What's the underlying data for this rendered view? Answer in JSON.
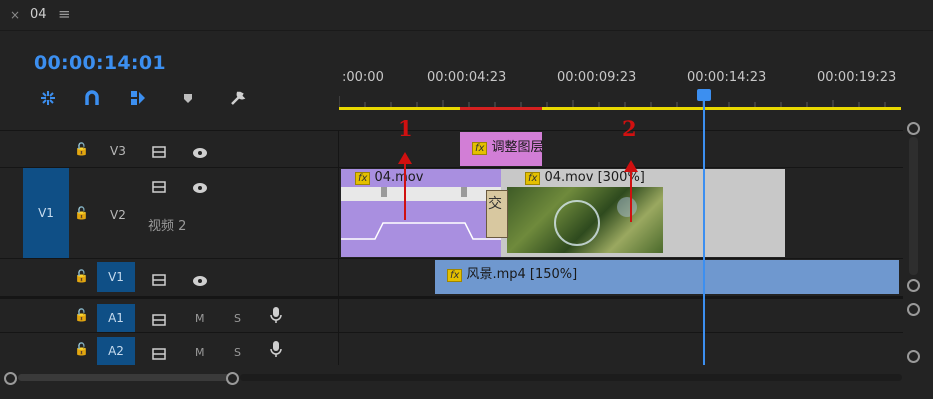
{
  "tab": {
    "close_glyph": "×",
    "name": "04",
    "menu_glyph": "≡"
  },
  "timecode": "00:00:14:01",
  "ruler": {
    "ticks": [
      ":00:00",
      "00:00:04:23",
      "00:00:09:23",
      "00:00:14:23",
      "00:00:19:23"
    ]
  },
  "tracks": {
    "v3": {
      "label": "V3"
    },
    "v2": {
      "label": "V2",
      "name": "视频 2",
      "source_patch": "V1"
    },
    "v1": {
      "label": "V1"
    },
    "a1": {
      "label": "A1",
      "m": "M",
      "s": "S"
    },
    "a2": {
      "label": "A2",
      "m": "M",
      "s": "S"
    }
  },
  "clips": {
    "adjust": {
      "fx": "fx",
      "label": "调整图层"
    },
    "clip1": {
      "fx": "fx",
      "label": "04.mov"
    },
    "clip2": {
      "fx": "fx",
      "label": "04.mov [300%]"
    },
    "transition": {
      "label": "交"
    },
    "scenery": {
      "fx": "fx",
      "label": "风景.mp4 [150%]"
    }
  },
  "annotations": {
    "one": "1",
    "two": "2"
  },
  "colors": {
    "accent": "#3c8ff0",
    "track_active": "#0f4f86",
    "adjust_clip": "#d27ed6",
    "video_clip": "#a98fe0",
    "nested_clip": "#c8c8c8",
    "audio_clip": "#6f98cf",
    "work_area": "#e8d800",
    "render_bar": "#d42020"
  }
}
